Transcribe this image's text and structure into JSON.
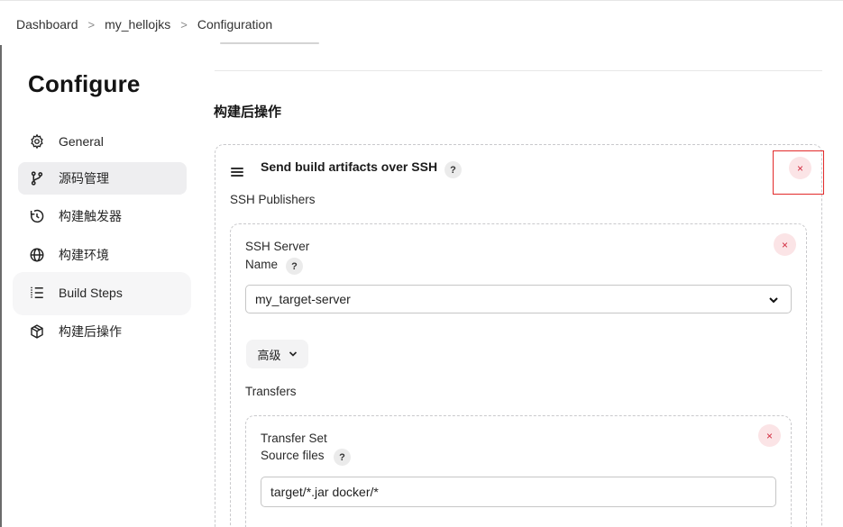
{
  "breadcrumb": {
    "items": [
      "Dashboard",
      "my_hellojks",
      "Configuration"
    ],
    "separator": ">"
  },
  "sidebar": {
    "title": "Configure",
    "items": [
      {
        "label": "General",
        "icon": "gear-icon",
        "active": false
      },
      {
        "label": "源码管理",
        "icon": "branch-icon",
        "active": true
      },
      {
        "label": "构建触发器",
        "icon": "clock-icon",
        "active": false
      },
      {
        "label": "构建环境",
        "icon": "globe-icon",
        "active": false
      },
      {
        "label": "Build Steps",
        "icon": "list-icon",
        "active": false
      },
      {
        "label": "构建后操作",
        "icon": "package-icon",
        "active": false
      }
    ]
  },
  "main": {
    "section_title": "构建后操作",
    "step": {
      "title": "Send build artifacts over SSH",
      "help": "?",
      "remove_label": "×",
      "publishers_label": "SSH Publishers",
      "server": {
        "title": "SSH Server",
        "name_label": "Name",
        "help": "?",
        "remove_label": "×",
        "selected_value": "my_target-server",
        "advanced_label": "高级",
        "transfers_label": "Transfers",
        "transfer_set": {
          "title": "Transfer Set",
          "source_label": "Source files",
          "help": "?",
          "remove_label": "×",
          "source_value": "target/*.jar docker/*"
        }
      }
    }
  },
  "colors": {
    "active_nav_bg": "#eeeef0",
    "close_bg": "#fbe4e6",
    "close_fg": "#d1293d",
    "highlight_outline": "#e22a2a",
    "dashed_border": "#c9c9cc"
  }
}
